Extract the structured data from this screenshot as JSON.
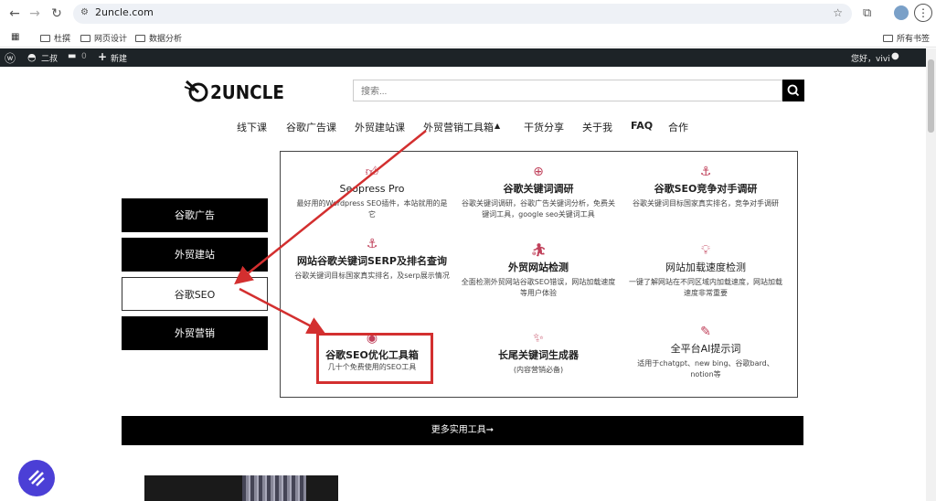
{
  "browser": {
    "url": "2uncle.com",
    "bookmarks": [
      "杜撰",
      "网页设计",
      "数据分析"
    ],
    "all_bookmarks": "所有书签"
  },
  "wpbar": {
    "site": "二叔",
    "comments": "0",
    "new": "新建",
    "greeting": "您好，vivi"
  },
  "header": {
    "logo": "2UNCLE",
    "search_placeholder": "搜索..."
  },
  "nav": {
    "items": [
      "线下课",
      "谷歌广告课",
      "外贸建站课",
      "外贸营销工具箱",
      "干货分享",
      "关于我",
      "FAQ",
      "合作"
    ],
    "dropdown_caret": "▲"
  },
  "sidebar": {
    "items": [
      "谷歌广告",
      "外贸建站",
      "谷歌SEO",
      "外贸营销"
    ]
  },
  "tools": [
    {
      "icon": "thumbs-up-icon",
      "title": "Seopress Pro",
      "desc": "最好用的Wordpress SEO插件，本站就用的是它"
    },
    {
      "icon": "search-plus-icon",
      "title": "谷歌关键词调研",
      "desc": "谷歌关键词调研，谷歌广告关键词分析，免费关键词工具，google seo关键词工具"
    },
    {
      "icon": "anchor-icon",
      "title": "谷歌SEO竞争对手调研",
      "desc": "谷歌关键词目标国家真实排名，竞争对手调研"
    },
    {
      "icon": "anchor-icon",
      "title": "网站谷歌关键词SERP及排名查询",
      "desc": "谷歌关键词目标国家真实排名，及serp展示情况"
    },
    {
      "icon": "user-check-icon",
      "title": "外贸网站检测",
      "desc": "全面检测外贸网站谷歌SEO错误，网站加载速度等用户体验"
    },
    {
      "icon": "lightbulb-icon",
      "title": "网站加载速度检测",
      "desc": "一键了解网站在不同区域内加载速度，网站加载速度非常重要"
    },
    {
      "icon": "eye-icon",
      "title": "谷歌SEO优化工具箱",
      "desc": "几十个免费使用的SEO工具"
    },
    {
      "icon": "magic-wand-icon",
      "title": "长尾关键词生成器",
      "desc": "(内容营销必备)"
    },
    {
      "icon": "edit-icon",
      "title": "全平台AI提示词",
      "desc": "适用于chatgpt、new bing、谷歌bard、notion等"
    }
  ],
  "more_button": "更多实用工具➞",
  "colors": {
    "accent": "#c0405a",
    "annotation": "#d32f2f",
    "wpbar": "#1d2327"
  }
}
